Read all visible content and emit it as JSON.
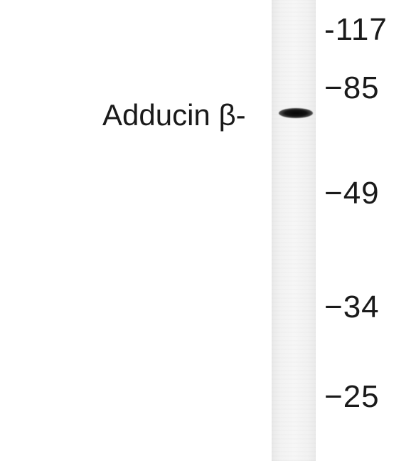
{
  "blot": {
    "band_label": "Adducin β-",
    "markers": [
      "-117",
      "−85",
      "−49",
      "−34",
      "−25"
    ]
  }
}
